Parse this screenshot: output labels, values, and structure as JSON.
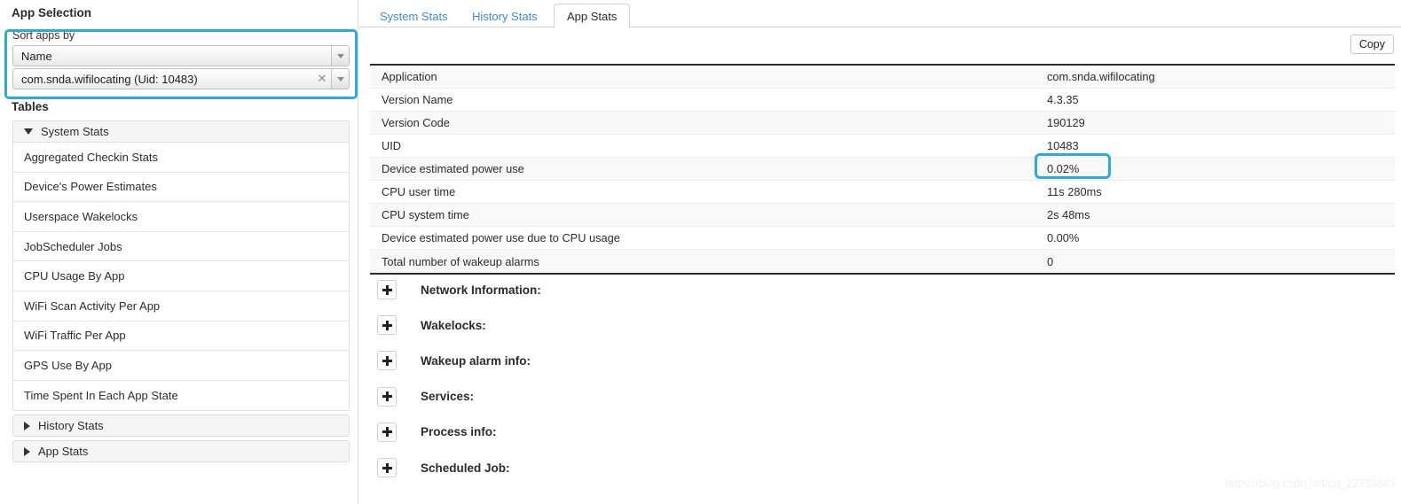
{
  "sidebar": {
    "app_selection_heading": "App Selection",
    "sort_label": "Sort apps by",
    "sort_select": {
      "value": "Name",
      "arrow_icon": "chevron-down-icon"
    },
    "app_select": {
      "value": "com.snda.wifilocating (Uid: 10483)",
      "clear_icon": "close-icon",
      "arrow_icon": "chevron-down-icon"
    },
    "tables_heading": "Tables",
    "groups": [
      {
        "label": "System Stats",
        "expanded": true,
        "toggle_icon": "triangle-down-icon",
        "items": [
          "Aggregated Checkin Stats",
          "Device's Power Estimates",
          "Userspace Wakelocks",
          "JobScheduler Jobs",
          "CPU Usage By App",
          "WiFi Scan Activity Per App",
          "WiFi Traffic Per App",
          "GPS Use By App",
          "Time Spent In Each App State"
        ]
      },
      {
        "label": "History Stats",
        "expanded": false,
        "toggle_icon": "triangle-right-icon",
        "items": []
      },
      {
        "label": "App Stats",
        "expanded": false,
        "toggle_icon": "triangle-right-icon",
        "items": []
      }
    ]
  },
  "main": {
    "tabs": [
      {
        "label": "System Stats",
        "active": false
      },
      {
        "label": "History Stats",
        "active": false
      },
      {
        "label": "App Stats",
        "active": true
      }
    ],
    "copy_label": "Copy",
    "table_rows": [
      {
        "key": "Application",
        "value": "com.snda.wifilocating"
      },
      {
        "key": "Version Name",
        "value": "4.3.35"
      },
      {
        "key": "Version Code",
        "value": "190129"
      },
      {
        "key": "UID",
        "value": "10483"
      },
      {
        "key": "Device estimated power use",
        "value": "0.02%"
      },
      {
        "key": "CPU user time",
        "value": "11s 280ms"
      },
      {
        "key": "CPU system time",
        "value": "2s 48ms"
      },
      {
        "key": "Device estimated power use due to CPU usage",
        "value": "0.00%"
      },
      {
        "key": "Total number of wakeup alarms",
        "value": "0"
      }
    ],
    "sections": [
      "Network Information:",
      "Wakelocks:",
      "Wakeup alarm info:",
      "Services:",
      "Process info:",
      "Scheduled Job:"
    ]
  },
  "watermark": "https://blog.csdn.net/qq_22753843",
  "colors": {
    "highlight": "#29abe2",
    "tab_link": "#3b8dd0"
  }
}
